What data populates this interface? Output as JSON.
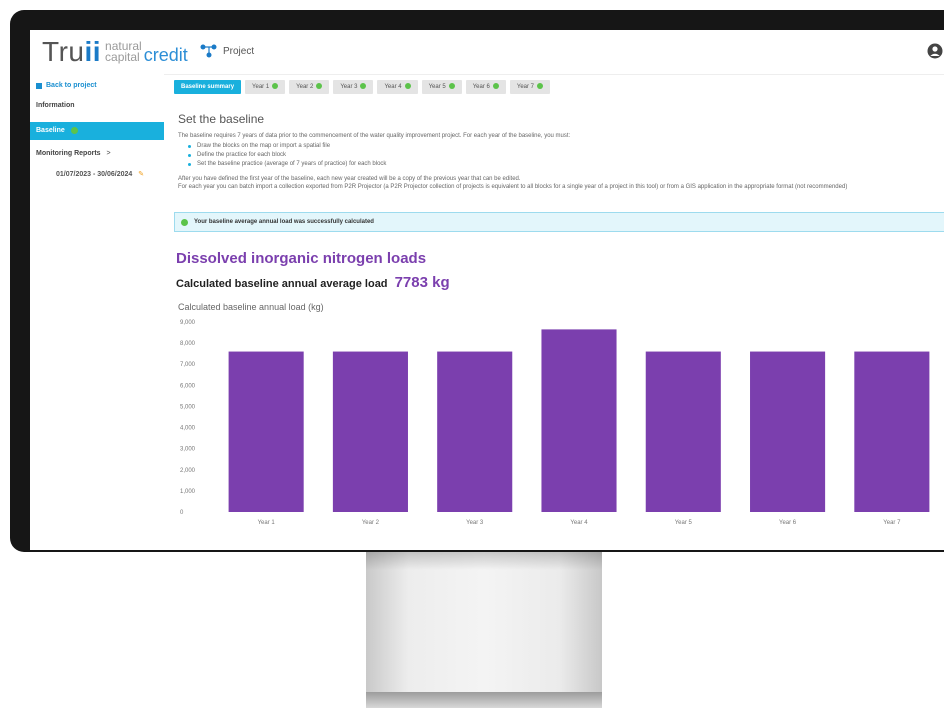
{
  "header": {
    "logo_truii_prefix": "Tru",
    "logo_truii_suffix": "ii",
    "logo_natural": "natural",
    "logo_capital": "capital",
    "logo_credit": "credit",
    "project_label": "Project",
    "icons": {
      "project": "network-icon",
      "user": "user-circle-icon"
    }
  },
  "sidebar": {
    "back_label": "Back to project",
    "information_label": "Information",
    "baseline_label": "Baseline",
    "monitoring_label": "Monitoring Reports",
    "monitoring_chevron": ">",
    "date_range": "01/07/2023 - 30/06/2024"
  },
  "tabs": [
    {
      "label": "Baseline summary",
      "active": true,
      "check": false
    },
    {
      "label": "Year 1",
      "active": false,
      "check": true
    },
    {
      "label": "Year 2",
      "active": false,
      "check": true
    },
    {
      "label": "Year 3",
      "active": false,
      "check": true
    },
    {
      "label": "Year 4",
      "active": false,
      "check": true
    },
    {
      "label": "Year 5",
      "active": false,
      "check": true
    },
    {
      "label": "Year 6",
      "active": false,
      "check": true
    },
    {
      "label": "Year 7",
      "active": false,
      "check": true
    }
  ],
  "content": {
    "heading": "Set the baseline",
    "intro": "The baseline requires 7 years of data prior to the commencement of the water quality improvement project. For each year of the baseline, you must:",
    "bullets": [
      "Draw the blocks on the map or import a spatial file",
      "Define the practice for each block",
      "Set the baseline practice (average of 7 years of practice) for each block"
    ],
    "after_1": "After you have defined the first year of the baseline, each new year created will be a copy of the previous year that can be edited.",
    "after_2": "For each year you can batch import a collection exported from P2R Projector (a P2R Projector collection of projects is equivalent to all blocks for a single year of a project in this tool) or from a GIS application in the appropriate format (not recommended)",
    "success_message": "Your baseline average annual load was successfully calculated",
    "section_title": "Dissolved inorganic nitrogen loads",
    "avg_label": "Calculated baseline annual average load",
    "avg_value": "7783 kg",
    "chart_caption": "Calculated baseline annual load (kg)"
  },
  "colors": {
    "accent": "#19b0dd",
    "purple": "#7b3fae",
    "bar": "#7b3fae",
    "success_bg": "#e3f6fb",
    "check": "#5cc34a"
  },
  "chart_data": {
    "type": "bar",
    "categories": [
      "Year 1",
      "Year 2",
      "Year 3",
      "Year 4",
      "Year 5",
      "Year 6",
      "Year 7"
    ],
    "values": [
      7600,
      7600,
      7600,
      8650,
      7600,
      7600,
      7600
    ],
    "ylim": [
      0,
      9000
    ],
    "yticks": [
      0,
      1000,
      2000,
      3000,
      4000,
      5000,
      6000,
      7000,
      8000,
      9000
    ],
    "ytick_labels": [
      "0",
      "1,000",
      "2,000",
      "3,000",
      "4,000",
      "5,000",
      "6,000",
      "7,000",
      "8,000",
      "9,000"
    ],
    "title": "Calculated baseline annual load (kg)",
    "xlabel": "",
    "ylabel": "",
    "grid": false,
    "legend": "none"
  }
}
